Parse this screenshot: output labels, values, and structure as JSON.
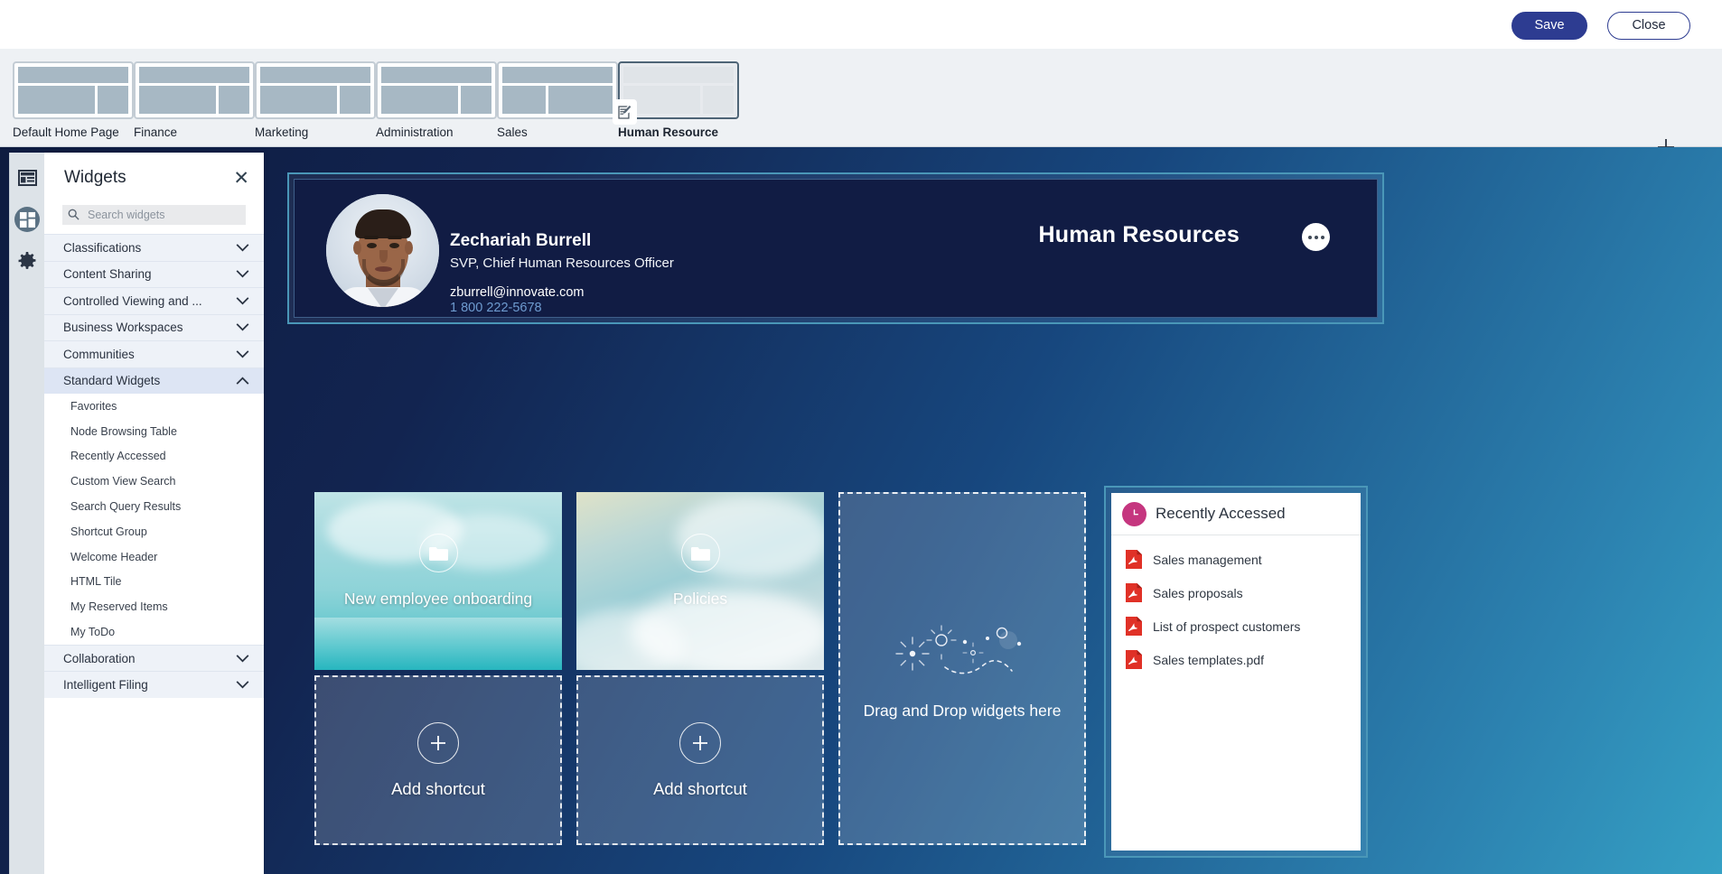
{
  "toolbar": {
    "save_label": "Save",
    "close_label": "Close"
  },
  "tabstrip": {
    "add_tab_icon": "plus-icon",
    "tabs": [
      {
        "label": "Default Home Page",
        "variant": "standard",
        "active": false
      },
      {
        "label": "Finance",
        "variant": "standard",
        "active": false
      },
      {
        "label": "Marketing",
        "variant": "standard",
        "active": false
      },
      {
        "label": "Administration",
        "variant": "standard",
        "active": false
      },
      {
        "label": "Sales",
        "variant": "wide-left",
        "active": false
      },
      {
        "label": "Human Resource",
        "variant": "standard",
        "active": true,
        "badge_icon": "edit-document-icon"
      }
    ]
  },
  "rail": {
    "items": [
      {
        "icon": "layout-panel-icon",
        "selected": false
      },
      {
        "icon": "widgets-grid-icon",
        "selected": true
      },
      {
        "icon": "gear-icon",
        "selected": false
      }
    ]
  },
  "widgets_panel": {
    "title": "Widgets",
    "close_icon": "close-icon",
    "search": {
      "icon": "search-icon",
      "value": "",
      "placeholder": "Search widgets"
    },
    "categories": [
      {
        "label": "Classifications",
        "expanded": false,
        "chevron": "chevron-down-icon",
        "items": []
      },
      {
        "label": "Content Sharing",
        "expanded": false,
        "chevron": "chevron-down-icon",
        "items": []
      },
      {
        "label": "Controlled Viewing and ...",
        "expanded": false,
        "chevron": "chevron-down-icon",
        "items": []
      },
      {
        "label": "Business Workspaces",
        "expanded": false,
        "chevron": "chevron-down-icon",
        "items": []
      },
      {
        "label": "Communities",
        "expanded": false,
        "chevron": "chevron-down-icon",
        "items": []
      },
      {
        "label": "Standard Widgets",
        "expanded": true,
        "chevron": "chevron-up-icon",
        "items": [
          "Favorites",
          "Node Browsing Table",
          "Recently Accessed",
          "Custom View Search",
          "Search Query Results",
          "Shortcut Group",
          "Welcome Header",
          "HTML Tile",
          "My Reserved Items",
          "My ToDo"
        ]
      },
      {
        "label": "Collaboration",
        "expanded": false,
        "chevron": "chevron-down-icon",
        "items": []
      },
      {
        "label": "Intelligent Filing",
        "expanded": false,
        "chevron": "chevron-down-icon",
        "items": []
      }
    ]
  },
  "banner": {
    "title": "Human Resources",
    "person": {
      "name": "Zechariah Burrell",
      "role": "SVP, Chief Human Resources Officer",
      "email": "zburrell@innovate.com",
      "phone": "1 800 222-5678",
      "avatar_icon": "user-photo-avatar"
    },
    "menu_icon": "more-options-icon"
  },
  "tiles": [
    {
      "name": "onboarding",
      "label": "New employee onboarding",
      "icon": "folder-icon"
    },
    {
      "name": "policies",
      "label": "Policies",
      "icon": "folder-icon"
    },
    {
      "name": "add-1",
      "label": "Add shortcut",
      "icon": "plus-icon"
    },
    {
      "name": "add-2",
      "label": "Add shortcut",
      "icon": "plus-icon"
    }
  ],
  "dropzone": {
    "label": "Drag and Drop widgets here",
    "art_icon": "sparkle-trail-icon"
  },
  "recently_accessed": {
    "title": "Recently Accessed",
    "icon": "clock-icon",
    "items": [
      {
        "label": "Sales management",
        "icon": "pdf-icon"
      },
      {
        "label": "Sales proposals",
        "icon": "pdf-icon"
      },
      {
        "label": "List of prospect customers",
        "icon": "pdf-icon"
      },
      {
        "label": "Sales templates.pdf",
        "icon": "pdf-icon"
      }
    ]
  },
  "colors": {
    "accent_blue": "#2d3c91",
    "banner_navy": "#111c44",
    "widget_border": "#4a97b8",
    "pdf_red": "#e03127",
    "clock_pink": "#c5367f",
    "phone_blue": "#6e9bd0"
  }
}
